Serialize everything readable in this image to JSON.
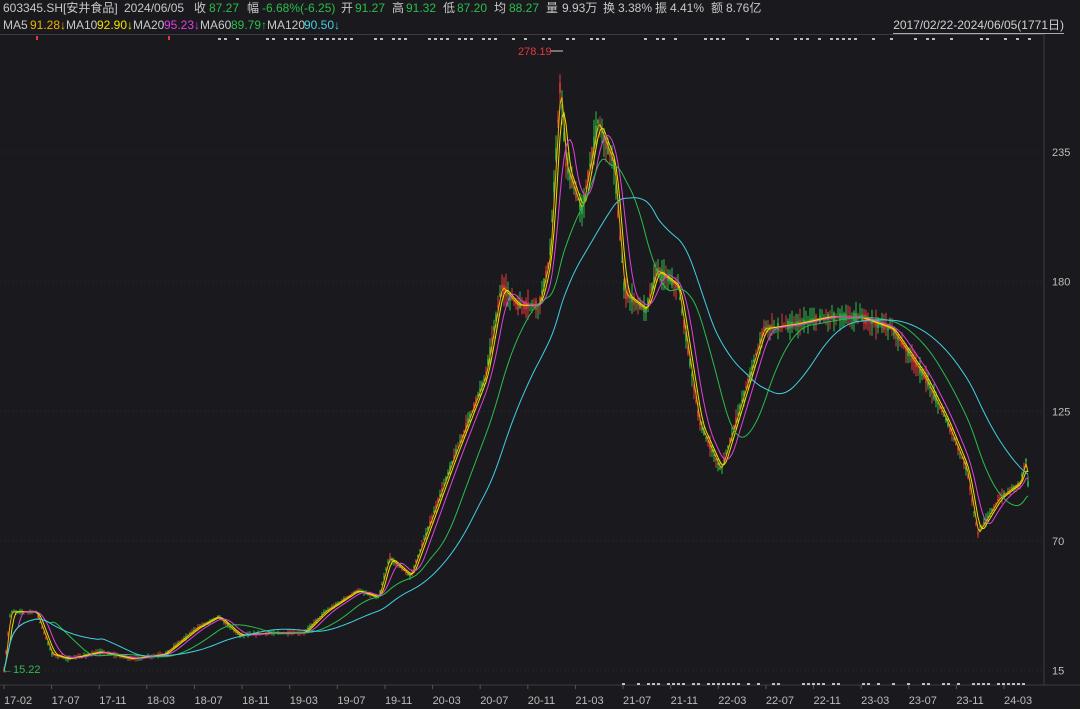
{
  "header": {
    "code": "603345.SH[安井食品]",
    "date": "2024/06/05",
    "close_label": "收",
    "close": "87.27",
    "change_label": "幅",
    "change": "-6.68%(-6.25)",
    "open_label": "开",
    "open": "91.27",
    "high_label": "高",
    "high": "91.32",
    "low_label": "低",
    "low": "87.20",
    "avg_label": "均",
    "avg": "88.27",
    "volume_label": "量",
    "volume": "9.93万",
    "turnover_label": "换",
    "turnover": "3.38%",
    "amplitude_label": "振",
    "amplitude": "4.41%",
    "amount_label": "额",
    "amount": "8.76亿"
  },
  "ma_bar": [
    {
      "name": "MA5",
      "value": "91.28↓",
      "color": "#f0b000"
    },
    {
      "name": "MA10",
      "value": "92.90↓",
      "color": "#f0e000"
    },
    {
      "name": "MA20",
      "value": "95.23↓",
      "color": "#e040e0"
    },
    {
      "name": "MA60",
      "value": "89.79↑",
      "color": "#2bbd4a"
    },
    {
      "name": "MA120",
      "value": "90.50↓",
      "color": "#40d0e0"
    }
  ],
  "range_label": "2017/02/22-2024/06/05(1771日)",
  "colors": {
    "up": "#e23a3a",
    "down": "#2bbd4a",
    "background": "#1a1a1e",
    "grid": "#2a2a30"
  },
  "chart_data": {
    "type": "candlestick",
    "y_ticks": [
      "235",
      "180",
      "125",
      "70",
      "15"
    ],
    "y_tick_values": [
      235,
      180,
      125,
      70,
      15
    ],
    "ylim": [
      0,
      291
    ],
    "x_ticks": [
      "17-02",
      "17-07",
      "17-11",
      "18-03",
      "18-07",
      "18-11",
      "19-03",
      "19-07",
      "19-11",
      "20-03",
      "20-07",
      "20-11",
      "21-03",
      "21-07",
      "21-11",
      "22-03",
      "22-07",
      "22-11",
      "23-03",
      "23-07",
      "23-11",
      "24-03"
    ],
    "annotations": {
      "max_label": "278.19",
      "min_label": "←15.22"
    },
    "close_path": [
      {
        "x": 0,
        "y": 15
      },
      {
        "x": 0.006,
        "y": 40
      },
      {
        "x": 0.03,
        "y": 40
      },
      {
        "x": 0.045,
        "y": 22
      },
      {
        "x": 0.06,
        "y": 20
      },
      {
        "x": 0.09,
        "y": 23
      },
      {
        "x": 0.12,
        "y": 20
      },
      {
        "x": 0.15,
        "y": 22
      },
      {
        "x": 0.18,
        "y": 33
      },
      {
        "x": 0.2,
        "y": 38
      },
      {
        "x": 0.22,
        "y": 30
      },
      {
        "x": 0.25,
        "y": 31
      },
      {
        "x": 0.28,
        "y": 31
      },
      {
        "x": 0.3,
        "y": 40
      },
      {
        "x": 0.33,
        "y": 49
      },
      {
        "x": 0.35,
        "y": 46
      },
      {
        "x": 0.36,
        "y": 63
      },
      {
        "x": 0.38,
        "y": 55
      },
      {
        "x": 0.4,
        "y": 80
      },
      {
        "x": 0.42,
        "y": 105
      },
      {
        "x": 0.45,
        "y": 140
      },
      {
        "x": 0.465,
        "y": 178
      },
      {
        "x": 0.48,
        "y": 170
      },
      {
        "x": 0.5,
        "y": 170
      },
      {
        "x": 0.51,
        "y": 190
      },
      {
        "x": 0.52,
        "y": 265
      },
      {
        "x": 0.525,
        "y": 230
      },
      {
        "x": 0.54,
        "y": 210
      },
      {
        "x": 0.555,
        "y": 248
      },
      {
        "x": 0.57,
        "y": 230
      },
      {
        "x": 0.58,
        "y": 175
      },
      {
        "x": 0.6,
        "y": 168
      },
      {
        "x": 0.61,
        "y": 185
      },
      {
        "x": 0.63,
        "y": 178
      },
      {
        "x": 0.65,
        "y": 120
      },
      {
        "x": 0.67,
        "y": 100
      },
      {
        "x": 0.69,
        "y": 130
      },
      {
        "x": 0.71,
        "y": 160
      },
      {
        "x": 0.74,
        "y": 162
      },
      {
        "x": 0.77,
        "y": 165
      },
      {
        "x": 0.8,
        "y": 165
      },
      {
        "x": 0.83,
        "y": 160
      },
      {
        "x": 0.86,
        "y": 140
      },
      {
        "x": 0.88,
        "y": 122
      },
      {
        "x": 0.9,
        "y": 100
      },
      {
        "x": 0.91,
        "y": 73
      },
      {
        "x": 0.93,
        "y": 88
      },
      {
        "x": 0.95,
        "y": 95
      },
      {
        "x": 0.955,
        "y": 105
      },
      {
        "x": 0.958,
        "y": 89
      }
    ]
  }
}
